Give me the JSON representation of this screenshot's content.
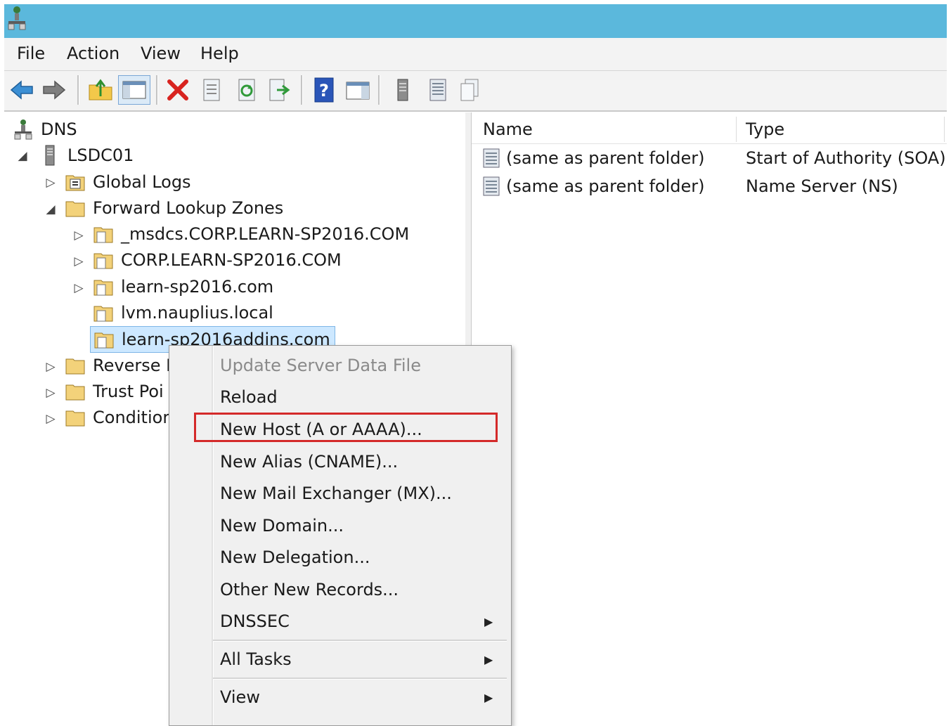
{
  "menubar": {
    "file": "File",
    "action": "Action",
    "view": "View",
    "help": "Help"
  },
  "toolbar": {
    "icons": [
      "back-arrow-icon",
      "forward-arrow-icon",
      "up-folder-icon",
      "show-hide-tree-icon",
      "delete-icon",
      "properties-icon",
      "refresh-icon",
      "export-list-icon",
      "help-icon",
      "show-hide-action-pane-icon",
      "server-icon",
      "list-icon",
      "copy-icon"
    ]
  },
  "tree": {
    "root": "DNS",
    "server": "LSDC01",
    "global_logs": "Global Logs",
    "forward_zones": "Forward Lookup Zones",
    "zones": [
      "_msdcs.CORP.LEARN-SP2016.COM",
      "CORP.LEARN-SP2016.COM",
      "learn-sp2016.com",
      "lvm.nauplius.local",
      "learn-sp2016addins.com"
    ],
    "reverse": "Reverse L",
    "trust": "Trust Poi",
    "conditional": "Conditior"
  },
  "list": {
    "columns": {
      "name": "Name",
      "type": "Type"
    },
    "rows": [
      {
        "name": "(same as parent folder)",
        "type": "Start of Authority (SOA)"
      },
      {
        "name": "(same as parent folder)",
        "type": "Name Server (NS)"
      }
    ]
  },
  "context_menu": {
    "update": "Update Server Data File",
    "reload": "Reload",
    "new_host": "New Host (A or AAAA)...",
    "new_alias": "New Alias (CNAME)...",
    "new_mx": "New Mail Exchanger (MX)...",
    "new_domain": "New Domain...",
    "new_delegation": "New Delegation...",
    "other_records": "Other New Records...",
    "dnssec": "DNSSEC",
    "all_tasks": "All Tasks",
    "view": "View"
  },
  "colors": {
    "titlebar": "#5bb8dc",
    "highlight_border": "#d42a2a",
    "selection_bg": "#cde8ff"
  }
}
